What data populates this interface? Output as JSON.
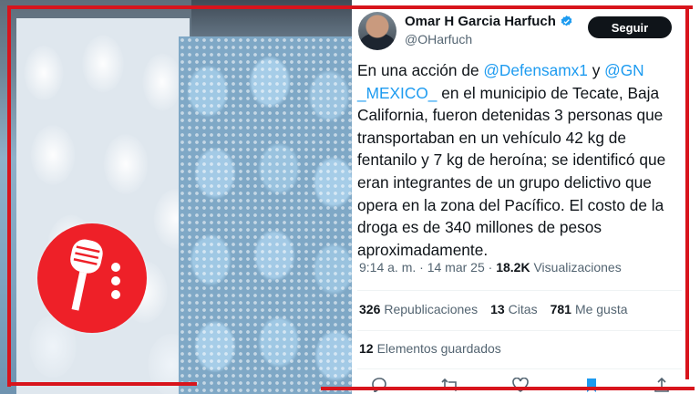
{
  "tweet": {
    "author_name": "Omar H Garcia Harfuch",
    "handle": "@OHarfuch",
    "follow_label": "Seguir",
    "text_part1": "En una acción de ",
    "mention1": "@Defensamx1",
    "text_part2": " y ",
    "mention2": "@GN\n_MEXICO_",
    "text_part3": " en el municipio de Tecate, Baja California, fueron detenidas 3 personas que transportaban en un vehículo 42 kg de fentanilo y 7 kg de heroína; se identificó que eran integrantes de un grupo delictivo que opera en la zona del Pacífico. El costo de la droga es de 340 millones de pesos aproximadamente.",
    "time": "9:14 a. m.",
    "date": "14 mar 25",
    "separator": "·",
    "views_count": "18.2K",
    "views_label": "Visualizaciones",
    "reposts_count": "326",
    "reposts_label": "Republicaciones",
    "quotes_count": "13",
    "quotes_label": "Citas",
    "likes_count": "781",
    "likes_label": "Me gusta",
    "bookmarks_count": "12",
    "bookmarks_label": "Elementos guardados"
  },
  "colors": {
    "frame_red": "#d8141c",
    "badge_red": "#ee2028",
    "mention_blue": "#1d9bf0",
    "verified_blue": "#1d9bf0"
  },
  "icons": [
    "microphone-icon",
    "verified-badge-icon",
    "reply-icon",
    "repost-icon",
    "like-icon",
    "bookmark-icon",
    "share-icon"
  ]
}
